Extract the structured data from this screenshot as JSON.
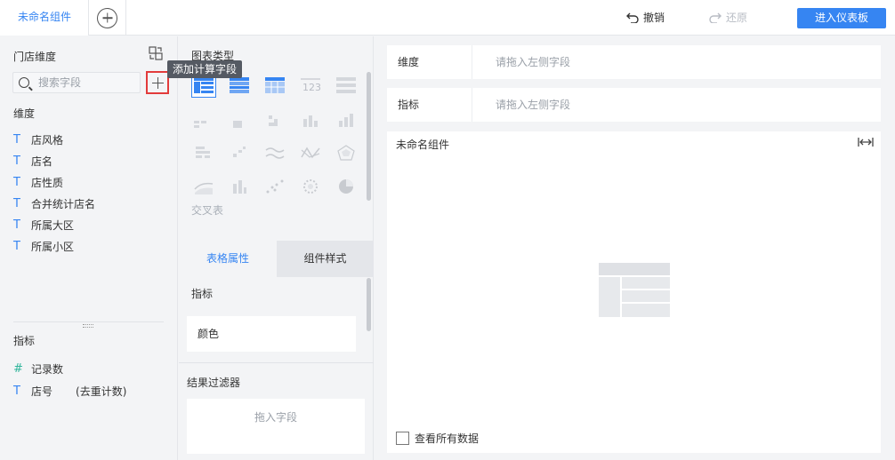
{
  "topbar": {
    "tab_label": "未命名组件",
    "undo_label": "撤销",
    "redo_label": "还原",
    "enter_label": "进入仪表板",
    "accent": "#3685f2"
  },
  "left": {
    "dataset_title": "门店维度",
    "search_placeholder": "搜索字段",
    "tooltip": "添加计算字段",
    "dimension_label": "维度",
    "dimensions": [
      {
        "icon": "T",
        "label": "店风格"
      },
      {
        "icon": "T",
        "label": "店名"
      },
      {
        "icon": "T",
        "label": "店性质"
      },
      {
        "icon": "T",
        "label": "合并统计店名"
      },
      {
        "icon": "T",
        "label": "所属大区"
      },
      {
        "icon": "T",
        "label": "所属小区"
      }
    ],
    "measure_label": "指标",
    "measures": [
      {
        "icon": "#",
        "label": "记录数",
        "extra": ""
      },
      {
        "icon": "T",
        "label": "店号",
        "extra": "(去重计数)"
      }
    ]
  },
  "mid": {
    "chart_type_title": "图表类型",
    "crosstab_label": "交叉表",
    "tabs": [
      "表格属性",
      "组件样式"
    ],
    "indicator_label": "指标",
    "color_label": "颜色",
    "filter_label": "结果过滤器",
    "filter_placeholder": "拖入字段"
  },
  "right": {
    "dimension_shelf": {
      "label": "维度",
      "placeholder": "请拖入左侧字段"
    },
    "measure_shelf": {
      "label": "指标",
      "placeholder": "请拖入左侧字段"
    },
    "component_name": "未命名组件",
    "check_all_label": "查看所有数据"
  }
}
